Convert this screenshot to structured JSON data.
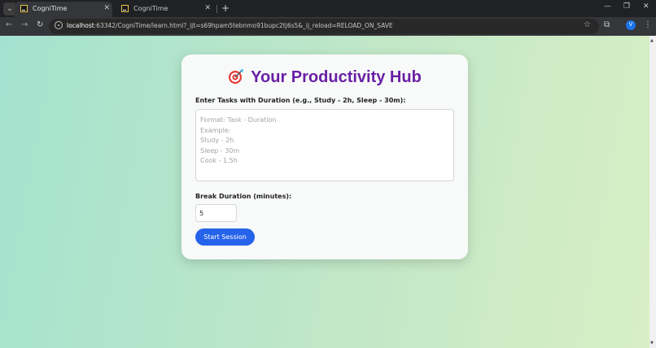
{
  "browser": {
    "tabs": [
      {
        "title": "CogniTime",
        "active": true
      },
      {
        "title": "CogniTime",
        "active": false
      }
    ],
    "url_host": "localhost",
    "url_rest": ":63342/CogniTime/learn.html?_ijt=s69hpam5tebnmo91bupc2tj6s5&_ij_reload=RELOAD_ON_SAVE",
    "profile_initial": "V",
    "icons": {
      "tab_search": "chevron-down-icon",
      "close": "close-icon",
      "new_tab": "plus-icon",
      "back": "back-arrow-icon",
      "forward": "forward-arrow-icon",
      "reload": "reload-icon",
      "site_info": "site-info-icon",
      "bookmark": "star-icon",
      "extensions": "puzzle-icon",
      "menu": "kebab-menu-icon"
    }
  },
  "app": {
    "title": "Your Productivity Hub",
    "title_icon": "target-icon",
    "title_color": "#6a1fa6",
    "tasks_label": "Enter Tasks with Duration (e.g., Study - 2h, Sleep - 30m):",
    "tasks_value": "",
    "tasks_placeholder": "Format: Task - Duration\nExample:\nStudy - 2h\nSleep - 30m\nCook - 1.5h",
    "break_label": "Break Duration (minutes):",
    "break_value": "5",
    "start_button": "Start Session",
    "accent_color": "#2563eb"
  }
}
